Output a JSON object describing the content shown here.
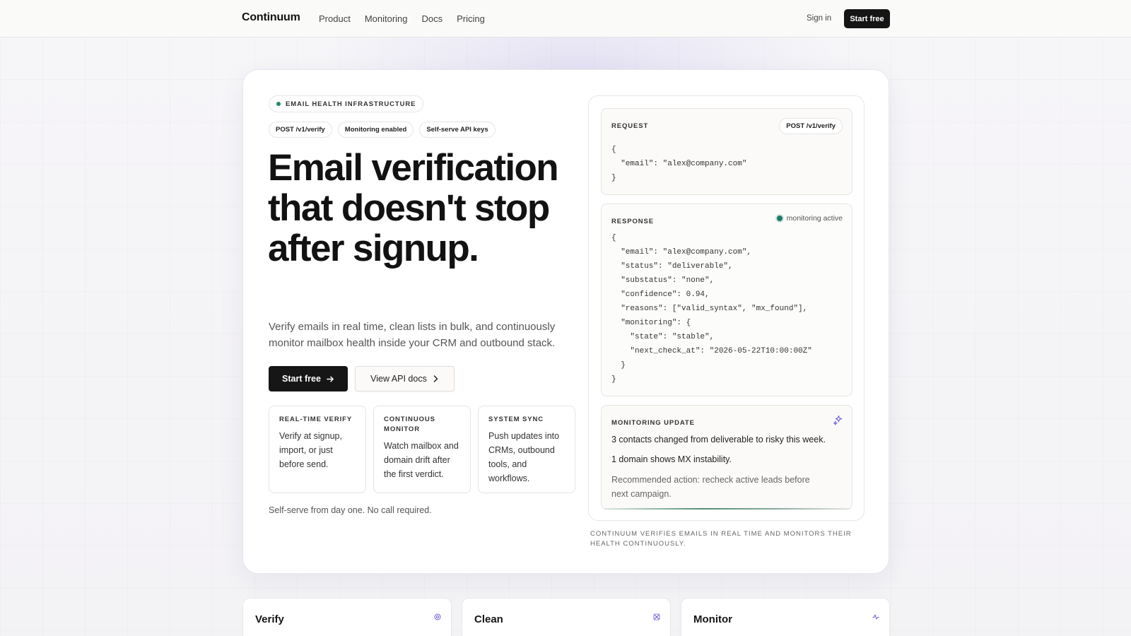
{
  "nav": {
    "brand": "Continuum",
    "links": [
      "Product",
      "Monitoring",
      "Docs",
      "Pricing"
    ],
    "sign_in": "Sign in",
    "cta": "Start free"
  },
  "hero": {
    "eyebrow": "EMAIL HEALTH INFRASTRUCTURE",
    "chips": [
      "POST /v1/verify",
      "Monitoring enabled",
      "Self-serve API keys"
    ],
    "headline": "Email verification that doesn't stop after signup.",
    "subhead": "Verify emails in real time, clean lists in bulk, and continuously monitor mailbox health inside your CRM and outbound stack.",
    "primary_cta": "Start free",
    "secondary_cta": "View API docs",
    "features": [
      {
        "title": "REAL-TIME VERIFY",
        "desc": "Verify at signup, import, or just before send."
      },
      {
        "title": "CONTINUOUS MONITOR",
        "desc": "Watch mailbox and domain drift after the first verdict."
      },
      {
        "title": "SYSTEM SYNC",
        "desc": "Push updates into CRMs, outbound tools, and workflows."
      }
    ],
    "footnote": "Self-serve from day one. No call required."
  },
  "panel": {
    "request": {
      "label": "REQUEST",
      "endpoint": "POST /v1/verify",
      "code": "{\n  \"email\": \"alex@company.com\"\n}"
    },
    "response": {
      "label": "RESPONSE",
      "status": "monitoring active",
      "code": "{\n  \"email\": \"alex@company.com\",\n  \"status\": \"deliverable\",\n  \"substatus\": \"none\",\n  \"confidence\": 0.94,\n  \"reasons\": [\"valid_syntax\", \"mx_found\"],\n  \"monitoring\": {\n    \"state\": \"stable\",\n    \"next_check_at\": \"2026-05-22T10:00:00Z\"\n  }\n}"
    },
    "monitoring": {
      "label": "MONITORING UPDATE",
      "line1": "3 contacts changed from deliverable to risky this week.",
      "line2": "1 domain shows MX instability.",
      "line3": "Recommended action: recheck active leads before next campaign."
    },
    "caption": "CONTINUUM VERIFIES EMAILS IN REAL TIME AND MONITORS THEIR HEALTH CONTINUOUSLY."
  },
  "cards": [
    {
      "title": "Verify",
      "icon": "target-icon"
    },
    {
      "title": "Clean",
      "icon": "broom-icon"
    },
    {
      "title": "Monitor",
      "icon": "pulse-icon"
    }
  ],
  "colors": {
    "accent": "#6b5bd8",
    "status_green": "#1f8a6a",
    "dark": "#151515"
  }
}
